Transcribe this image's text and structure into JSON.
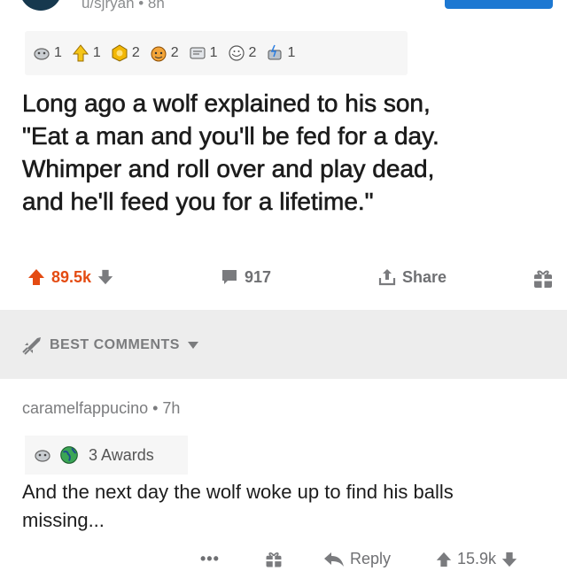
{
  "post": {
    "author_line": "u/sjryan • 8h",
    "awards": [
      {
        "icon": "silver-award-icon",
        "count": "1"
      },
      {
        "icon": "rocket-like-award-icon",
        "count": "1"
      },
      {
        "icon": "gold-award-icon",
        "count": "2"
      },
      {
        "icon": "wholesome-award-icon",
        "count": "2"
      },
      {
        "icon": "helpful-award-icon",
        "count": "1"
      },
      {
        "icon": "hugs-award-icon",
        "count": "2"
      },
      {
        "icon": "take-my-energy-award-icon",
        "count": "1"
      }
    ],
    "title_lines": [
      "Long ago a wolf explained to his son,",
      "\"Eat a man and you'll be fed for a day.",
      "Whimper and roll over and play dead,",
      "and he'll feed you for a lifetime.\""
    ],
    "upvotes": "89.5k",
    "comments": "917",
    "share_label": "Share"
  },
  "section": {
    "sort_label": "BEST COMMENTS"
  },
  "comment": {
    "author_line": "caramelfappucino • 7h",
    "awards_label": "3 Awards",
    "text_lines": [
      "And the next day the wolf woke up to find his balls",
      "missing..."
    ],
    "more": "•••",
    "reply_label": "Reply",
    "upvotes": "15.9k"
  },
  "colors": {
    "upvote": "#e44b12",
    "join_button": "#1d78d2",
    "divider": "#ededed"
  }
}
